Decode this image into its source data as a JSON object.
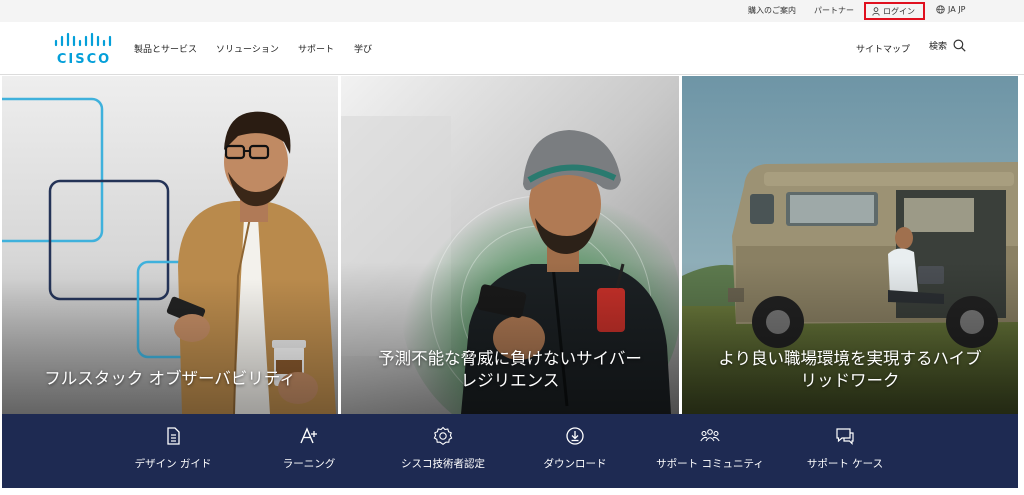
{
  "utility": {
    "buy": "購入のご案内",
    "partner": "パートナー",
    "login": "ログイン",
    "lang": "JA JP"
  },
  "header": {
    "logo": "CISCO",
    "nav": [
      "製品とサービス",
      "ソリューション",
      "サポート",
      "学び"
    ],
    "sitemap": "サイトマップ",
    "search": "検索"
  },
  "tiles": [
    {
      "caption": "フルスタック オブザーバビリティ"
    },
    {
      "caption_line1": "予測不能な脅威に負けないサイバー",
      "caption_line2": "レジリエンス"
    },
    {
      "caption_line1": "より良い職場環境を実現するハイブ",
      "caption_line2": "リッドワーク"
    }
  ],
  "quicklinks": [
    {
      "label": "デザイン ガイド",
      "icon": "document-icon"
    },
    {
      "label": "ラーニング",
      "icon": "learning-icon"
    },
    {
      "label": "シスコ技術者認定",
      "icon": "certification-badge-icon"
    },
    {
      "label": "ダウンロード",
      "icon": "download-icon"
    },
    {
      "label": "サポート コミュニティ",
      "icon": "community-icon"
    },
    {
      "label": "サポート ケース",
      "icon": "chat-icon"
    }
  ],
  "colors": {
    "brand": "#049fd9",
    "navy": "#1e2a52",
    "login_highlight": "#e0101f"
  }
}
